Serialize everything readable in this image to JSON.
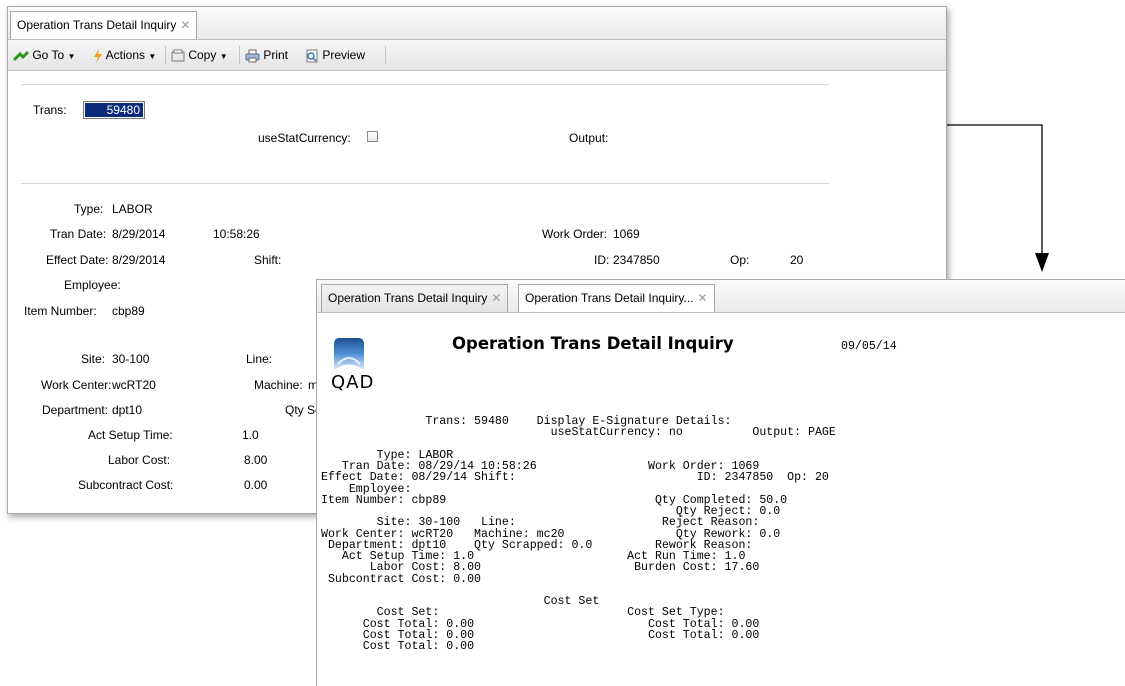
{
  "back_window": {
    "tab_title": "Operation Trans Detail Inquiry",
    "toolbar": {
      "goto": "Go To",
      "actions": "Actions",
      "copy": "Copy",
      "print": "Print",
      "preview": "Preview"
    },
    "trans_label": "Trans:",
    "trans_value": "59480",
    "usestat_label": "useStatCurrency:",
    "output_label": "Output:",
    "fields": {
      "type_label": "Type:",
      "type_value": "LABOR",
      "tran_date_label": "Tran Date:",
      "tran_date_value": "8/29/2014",
      "tran_time_value": "10:58:26",
      "work_order_label": "Work Order:",
      "work_order_value": "1069",
      "effect_date_label": "Effect Date:",
      "effect_date_value": "8/29/2014",
      "shift_label": "Shift:",
      "id_label": "ID:",
      "id_value": "2347850",
      "op_label": "Op:",
      "op_value": "20",
      "employee_label": "Employee:",
      "item_number_label": "Item Number:",
      "item_number_value": "cbp89",
      "site_label": "Site:",
      "site_value": "30-100",
      "line_label": "Line:",
      "work_center_label": "Work Center:",
      "work_center_value": "wcRT20",
      "machine_label": "Machine:",
      "machine_value": "m",
      "department_label": "Department:",
      "department_value": "dpt10",
      "qty_sc_label": "Qty Sc",
      "act_setup_label": "Act Setup Time:",
      "act_setup_value": "1.0",
      "labor_cost_label": "Labor Cost:",
      "labor_cost_value": "8.00",
      "subcontract_label": "Subcontract Cost:",
      "subcontract_value": "0.00"
    }
  },
  "front_window": {
    "tabs": [
      {
        "label": "Operation Trans Detail Inquiry"
      },
      {
        "label": "Operation Trans Detail Inquiry..."
      }
    ],
    "logo_text": "QAD",
    "report_title": "Operation Trans Detail Inquiry",
    "report_date": "09/05/14",
    "lines": [
      "               Trans: 59480    Display E-Signature Details:",
      "                                 useStatCurrency: no          Output: PAGE",
      "",
      "        Type: LABOR",
      "   Tran Date: 08/29/14 10:58:26                Work Order: 1069",
      "Effect Date: 08/29/14 Shift:                          ID: 2347850  Op: 20",
      "    Employee:",
      "Item Number: cbp89                              Qty Completed: 50.0",
      "                                                   Qty Reject: 0.0",
      "        Site: 30-100   Line:                     Reject Reason:",
      "Work Center: wcRT20   Machine: mc20                Qty Rework: 0.0",
      " Department: dpt10    Qty Scrapped: 0.0         Rework Reason:",
      "   Act Setup Time: 1.0                      Act Run Time: 1.0",
      "       Labor Cost: 8.00                      Burden Cost: 17.60",
      " Subcontract Cost: 0.00",
      "",
      "                                Cost Set",
      "        Cost Set:                           Cost Set Type:",
      "      Cost Total: 0.00                         Cost Total: 0.00",
      "      Cost Total: 0.00                         Cost Total: 0.00",
      "      Cost Total: 0.00"
    ]
  },
  "colors": {
    "selection": "#0a2c7a",
    "logo_blue": "#2f6db5"
  }
}
